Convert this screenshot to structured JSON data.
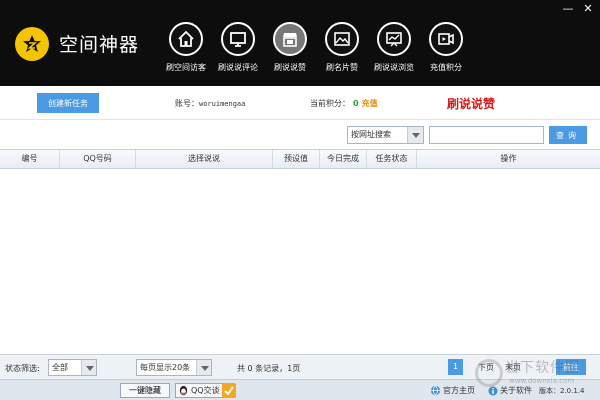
{
  "app": {
    "title": "空间神器"
  },
  "window": {
    "minimize": "—",
    "close": "✕"
  },
  "nav": [
    {
      "label": "刷空间访客",
      "icon": "home-icon"
    },
    {
      "label": "刷说说评论",
      "icon": "monitor-icon"
    },
    {
      "label": "刷说说赞",
      "icon": "store-icon"
    },
    {
      "label": "刷名片赞",
      "icon": "image-card-icon"
    },
    {
      "label": "刷说说浏览",
      "icon": "chart-screen-icon"
    },
    {
      "label": "充值积分",
      "icon": "video-icon"
    }
  ],
  "toolbar": {
    "create_label": "创建新任务",
    "account_label": "账号：",
    "account_value": "woruimengaa",
    "points_label": "当前积分：",
    "points_value": "0",
    "recharge_label": "充值",
    "mode_title": "刷说说赞"
  },
  "search": {
    "type_value": "按网址搜索",
    "query_value": "",
    "button_label": "查询"
  },
  "table": {
    "columns": [
      "编号",
      "QQ号码",
      "选择说说",
      "预设值",
      "今日完成",
      "任务状态",
      "操作"
    ],
    "rows": []
  },
  "footer": {
    "filter_label": "状态筛选:",
    "filter_value": "全部",
    "per_page_value": "每页显示20条",
    "summary": "共 0 条记录，1页",
    "current_page": "1",
    "next_label": "下页",
    "last_label": "末页",
    "go_label": "前往"
  },
  "statusbar": {
    "hide_label": "一键隐藏",
    "qq_chat_label": "QQ交谈",
    "home_label": "官方主页",
    "about_label": "关于软件",
    "version": "版本：2.0.1.4"
  },
  "watermark": {
    "cn": "当下软件园",
    "en": "www.downxia.com"
  },
  "colors": {
    "accent": "#4a9be3",
    "header": "#0d0d0d",
    "logo": "#f5c400",
    "title_red": "#d81818"
  }
}
